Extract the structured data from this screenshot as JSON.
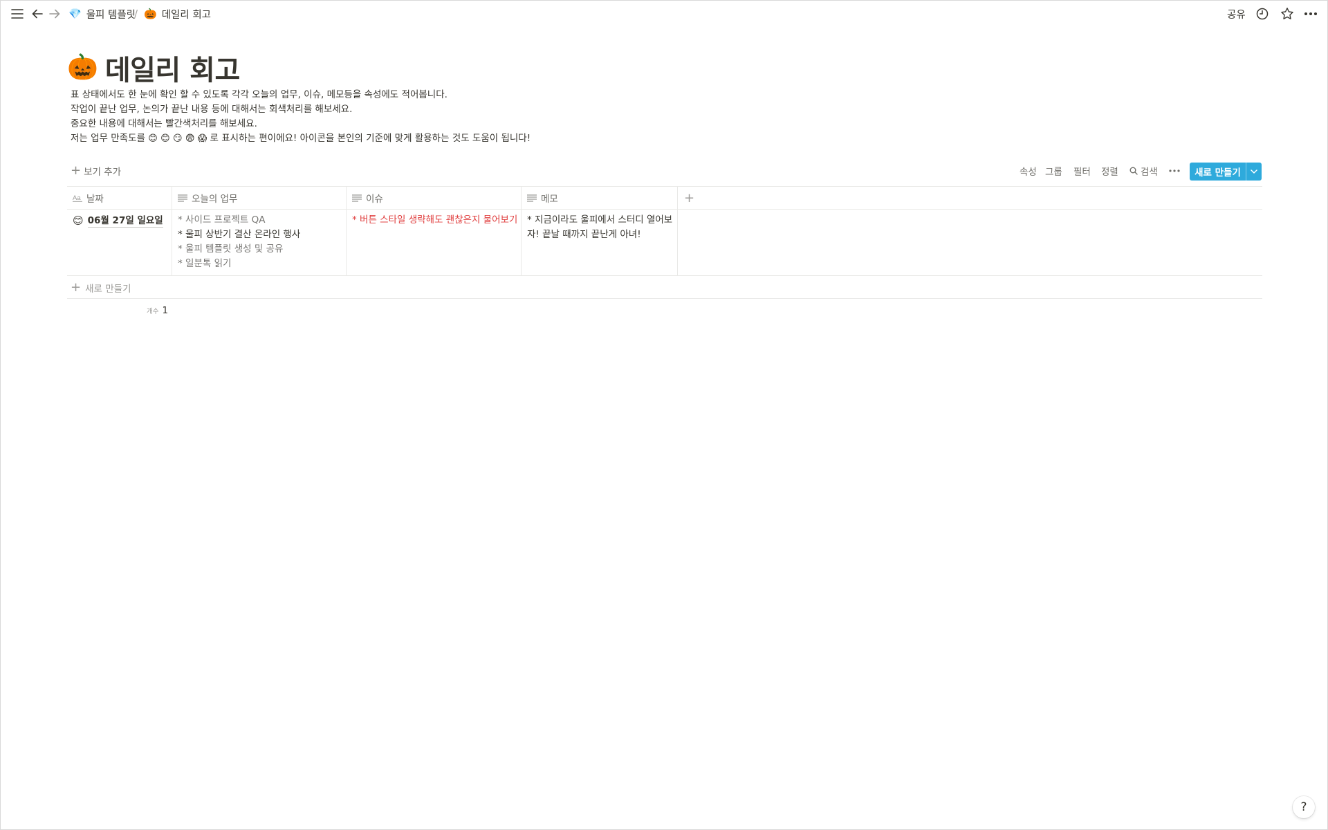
{
  "breadcrumb": {
    "parent": {
      "emoji": "💎",
      "label": "울피 템플릿"
    },
    "separator": "/",
    "current": {
      "emoji": "🎃",
      "label": "데일리 회고"
    }
  },
  "topbar": {
    "share_label": "공유",
    "icons": [
      "menu-icon",
      "back-arrow-icon",
      "forward-arrow-icon",
      "clock-icon",
      "star-icon",
      "more-icon"
    ]
  },
  "page": {
    "emoji": "🎃",
    "title": "데일리 회고",
    "description": [
      "표 상태에서도 한 눈에 확인 할 수 있도록 각각 오늘의 업무, 이슈, 메모등을 속성에도 적어봅니다.",
      "작업이 끝난 업무, 논의가 끝난 내용 등에 대해서는 회색처리를 해보세요.",
      "중요한 내용에 대해서는 빨간색처리를 해보세요."
    ],
    "description_last": {
      "before": "저는 업무 만족도를",
      "emojis": [
        "😊",
        "😊",
        "😏",
        "😨",
        "😱"
      ],
      "after": "로 표시하는 편이에요! 아이콘을 본인의 기준에 맞게 활용하는 것도 도움이 됩니다!"
    }
  },
  "toolbar": {
    "add_view": "보기 추가",
    "properties": "속성",
    "group": "그룹",
    "filter": "필터",
    "sort": "정렬",
    "search": "검색",
    "new_button": "새로 만들기",
    "accent_color": "#2eaadc"
  },
  "table": {
    "columns": [
      {
        "label": "날짜",
        "icon": "title-aa-icon"
      },
      {
        "label": "오늘의 업무",
        "icon": "text-lines-icon"
      },
      {
        "label": "이슈",
        "icon": "text-lines-icon"
      },
      {
        "label": "메모",
        "icon": "text-lines-icon"
      }
    ],
    "rows": [
      {
        "date_emoji": "😊",
        "date": "06월 27일 일요일",
        "tasks": [
          {
            "text": "* 사이드 프로젝트 QA",
            "style": "gray"
          },
          {
            "text": "* 울피 상반기 결산 온라인 행사",
            "style": "dark"
          },
          {
            "text": "* 울피 템플릿 생성 및 공유",
            "style": "gray"
          },
          {
            "text": "* 일분톡 읽기",
            "style": "gray"
          }
        ],
        "issue": "* 버튼 스타일 생략해도 괜찮은지 물어보기",
        "issue_color": "#e03e3e",
        "memo_lines": [
          "* 지금이라도 울피에서 스터디 열어보",
          "자! 끝날 때까지 끝난게 아녀!"
        ]
      }
    ],
    "new_row": "새로 만들기",
    "count_label": "개수",
    "count_value": "1"
  },
  "help_label": "?"
}
